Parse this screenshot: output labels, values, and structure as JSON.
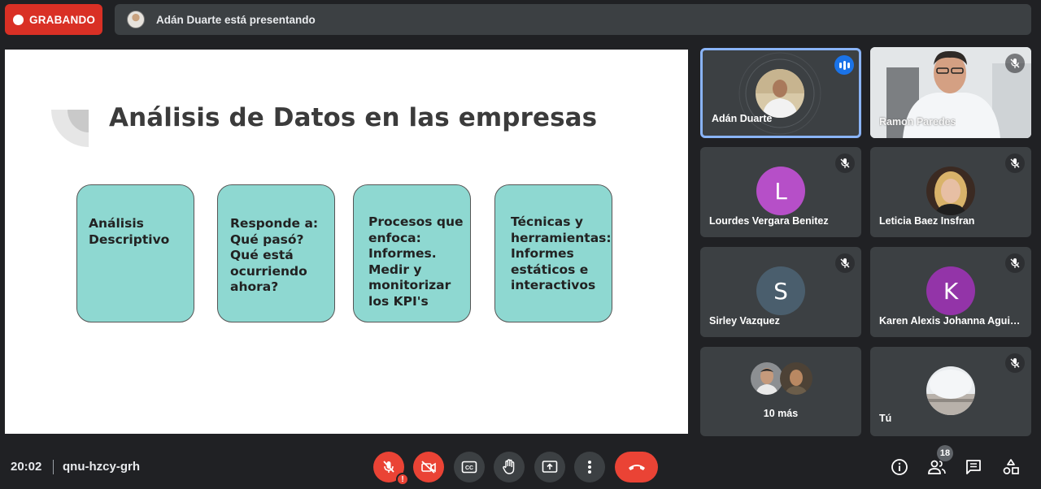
{
  "topbar": {
    "recording_label": "GRABANDO",
    "presenting_text": "Adán Duarte está presentando"
  },
  "slide": {
    "title": "Análisis de Datos en las empresas",
    "boxes": [
      {
        "text": "Análisis\nDescriptivo"
      },
      {
        "text": "Responde a:\nQué pasó?\nQué está\nocurriendo\nahora?"
      },
      {
        "text": "Procesos que\nenfoca:\nInformes.\nMedir y\nmonitorizar\nlos KPI's"
      },
      {
        "text": "Técnicas y\nherramientas:\nInformes\nestáticos e\ninteractivos"
      }
    ],
    "colors": {
      "box_fill": "#8ed8d1",
      "title": "#3b3b3b"
    }
  },
  "participants": [
    {
      "name": "Adán Duarte",
      "speaking": true,
      "muted": false
    },
    {
      "name": "Ramon Paredes",
      "muted": true
    },
    {
      "name": "Lourdes Vergara Benitez",
      "initial": "L",
      "avatar_color": "#b64fc8",
      "muted": true
    },
    {
      "name": "Leticia Baez Insfran",
      "muted": true
    },
    {
      "name": "Sirley Vazquez",
      "initial": "S",
      "avatar_color": "#4a5e6d",
      "muted": true
    },
    {
      "name": "Karen Alexis Johanna Aguilar",
      "initial": "K",
      "avatar_color": "#9334a8",
      "muted": true
    },
    {
      "name": "10 más"
    },
    {
      "name": "Tú",
      "muted": true
    }
  ],
  "bottombar": {
    "time": "20:02",
    "meeting_code": "qnu-hzcy-grh",
    "people_count": "18",
    "mic_warning": "!",
    "controls": [
      "mic-off-icon",
      "camera-off-icon",
      "captions-icon",
      "raise-hand-icon",
      "present-screen-icon",
      "more-options-icon",
      "end-call-icon"
    ],
    "right_icons": [
      "info-icon",
      "people-icon",
      "chat-icon",
      "activities-icon"
    ]
  },
  "colors": {
    "accent": "#8ab4f8",
    "danger": "#ea4335",
    "tile": "#3c4043",
    "background": "#202124"
  }
}
